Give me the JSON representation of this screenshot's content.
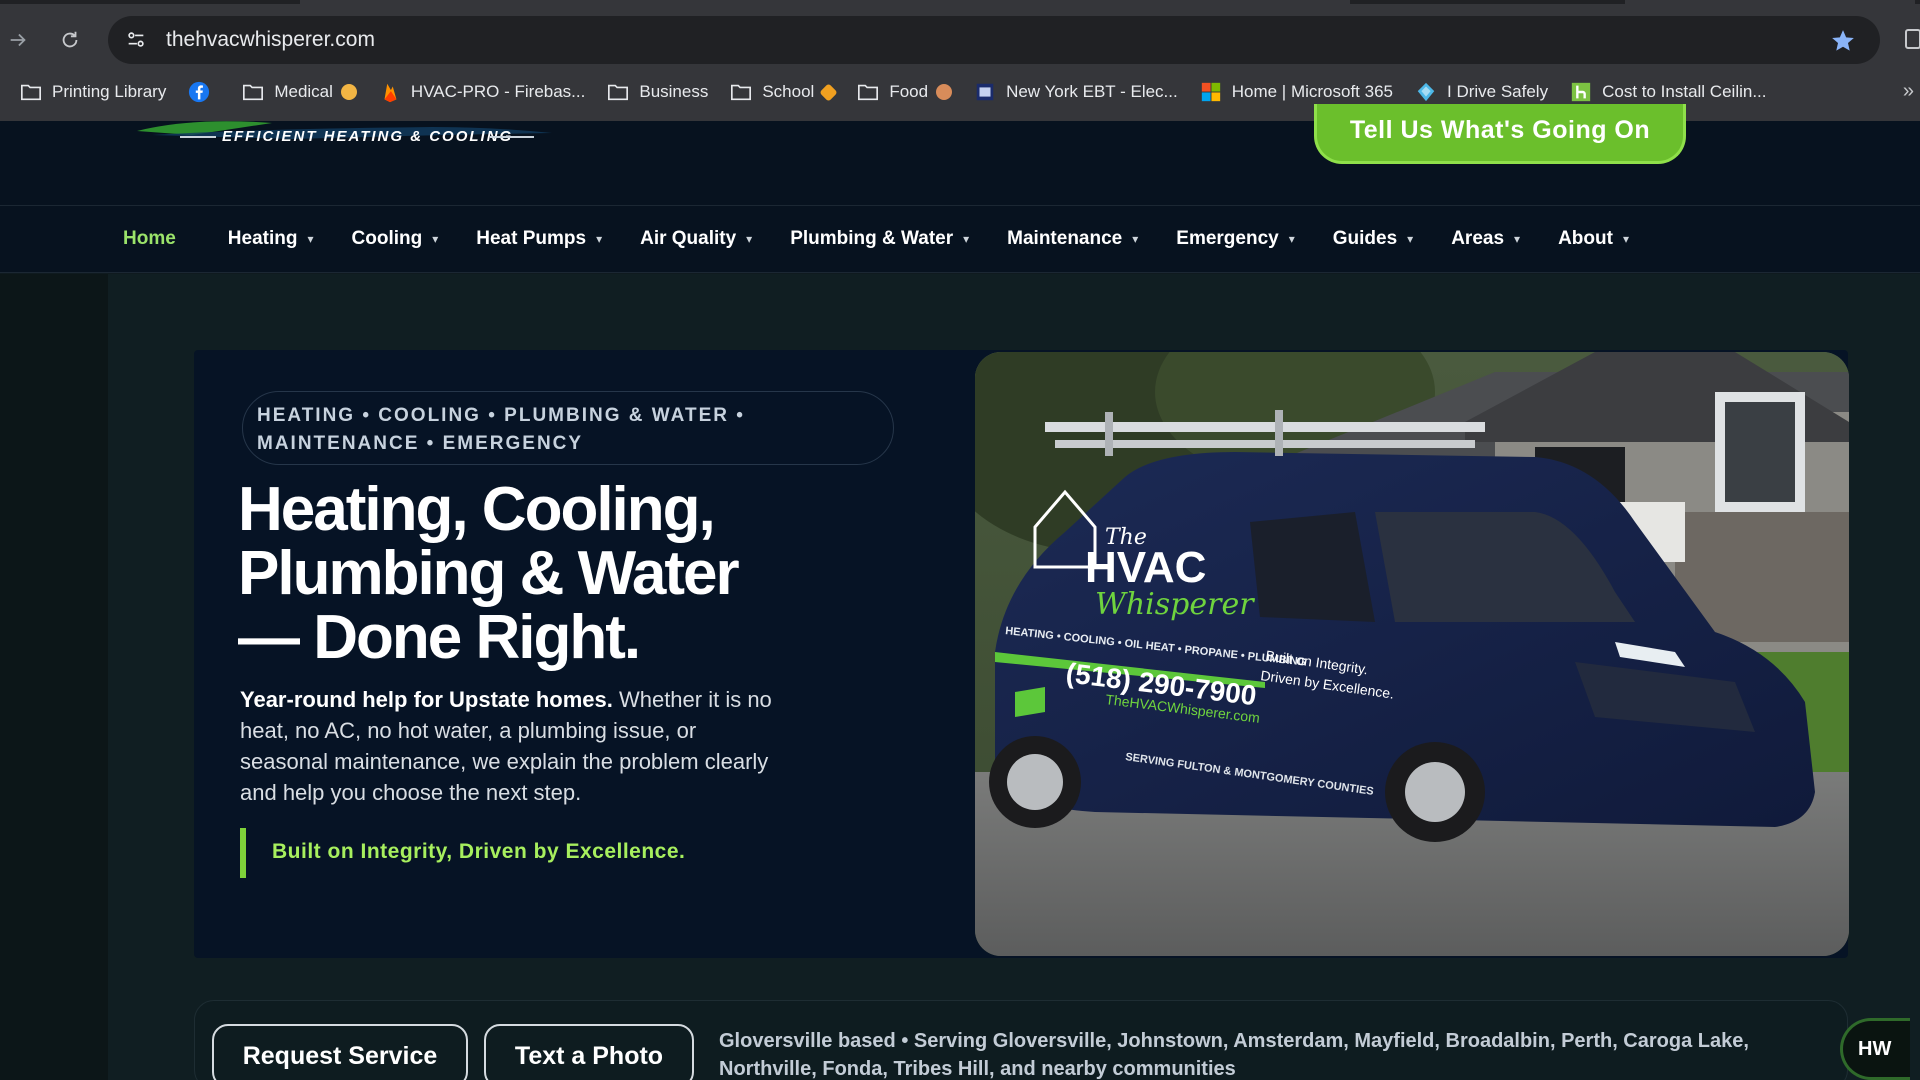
{
  "browser": {
    "url": "thehvacwhisperer.com",
    "bookmarks": [
      {
        "label": "Printing Library",
        "icon": "folder-icon"
      },
      {
        "label": "",
        "icon": "facebook-icon"
      },
      {
        "label": "Medical",
        "icon": "folder-icon"
      },
      {
        "label": "HVAC-PRO - Firebas...",
        "icon": "firebase-icon"
      },
      {
        "label": "Business",
        "icon": "folder-icon"
      },
      {
        "label": "School",
        "icon": "folder-icon"
      },
      {
        "label": "Food",
        "icon": "folder-icon"
      },
      {
        "label": "New York EBT - Elec...",
        "icon": "ebt-icon"
      },
      {
        "label": "Home | Microsoft 365",
        "icon": "microsoft-icon"
      },
      {
        "label": "I Drive Safely",
        "icon": "idrivesafely-icon"
      },
      {
        "label": "Cost to Install Ceilin...",
        "icon": "homeadvisor-icon"
      }
    ],
    "more": "»"
  },
  "header": {
    "logo_tagline": "EFFICIENT HEATING & COOLING",
    "cta": "Tell Us What's Going On"
  },
  "nav": {
    "items": [
      {
        "label": "Home",
        "active": true
      },
      {
        "label": "Heating",
        "caret": "▾"
      },
      {
        "label": "Cooling",
        "caret": "▾"
      },
      {
        "label": "Heat Pumps",
        "caret": "▾"
      },
      {
        "label": "Air Quality",
        "caret": "▾"
      },
      {
        "label": "Plumbing & Water",
        "caret": "▾"
      },
      {
        "label": "Maintenance",
        "caret": "▾"
      },
      {
        "label": "Emergency",
        "caret": "▾"
      },
      {
        "label": "Guides",
        "caret": "▾"
      },
      {
        "label": "Areas",
        "caret": "▾"
      },
      {
        "label": "About",
        "caret": "▾"
      }
    ]
  },
  "hero": {
    "pill_line1": "HEATING • COOLING • PLUMBING & WATER •",
    "pill_line2": "MAINTENANCE • EMERGENCY",
    "headline_line1": "Heating, Cooling,",
    "headline_line2": "Plumbing & Water",
    "headline_line3": "— Done Right.",
    "sub_bold": "Year-round help for Upstate homes.",
    "sub_rest": " Whether it is no heat, no AC, no hot water, a plumbing issue, or seasonal maintenance, we explain the problem clearly and help you choose the next step.",
    "tagline": "Built on Integrity, Driven by Excellence.",
    "van": {
      "brand_the": "The",
      "brand_name": "HVAC",
      "brand_script": "Whisperer",
      "services": "HEATING • COOLING • OIL HEAT • PROPANE • PLUMBING",
      "phone": "(518) 290-7900",
      "website": "TheHVACWhisperer.com",
      "slogan1": "Built on Integrity.",
      "slogan2": "Driven by Excellence.",
      "serving": "SERVING FULTON & MONTGOMERY COUNTIES"
    }
  },
  "actions": {
    "request": "Request Service",
    "photo": "Text a Photo",
    "areas": "Gloversville based • Serving Gloversville, Johnstown, Amsterdam, Mayfield, Broadalbin, Perth, Caroga Lake, Northville, Fonda, Tribes Hill, and nearby communities"
  },
  "chat_badge": "HW"
}
